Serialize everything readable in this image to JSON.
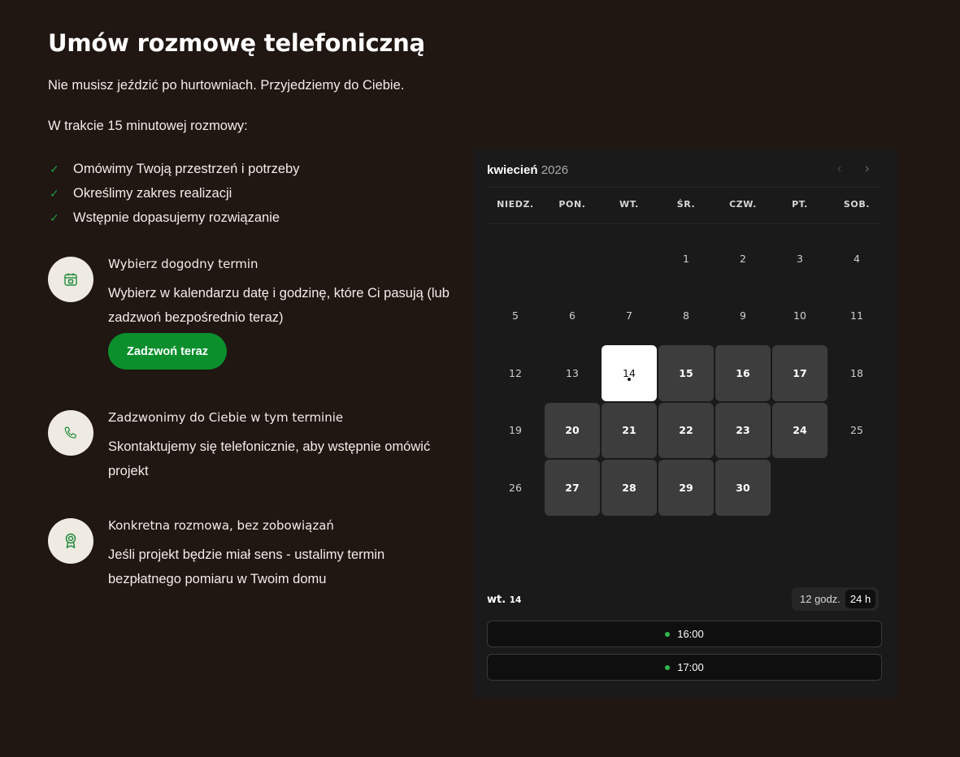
{
  "title": "Umów rozmowę telefoniczną",
  "intro": "Nie musisz jeździć po hurtowniach. Przyjedziemy do Ciebie.",
  "during": "W trakcie 15 minutowej rozmowy:",
  "checklist": [
    "Omówimy Twoją przestrzeń i potrzeby",
    "Określimy zakres realizacji",
    "Wstępnie dopasujemy rozwiązanie"
  ],
  "steps": [
    {
      "title": "Wybierz dogodny termin",
      "desc": "Wybierz w kalendarzu datę i godzinę, które Ci pasują (lub zadzwoń bezpośrednio teraz)",
      "icon": "calendar-icon"
    },
    {
      "title": "Zadzwonimy do Ciebie w tym terminie",
      "desc": "Skontaktujemy się telefonicznie, aby wstępnie omówić projekt",
      "icon": "phone-icon"
    },
    {
      "title": "Konkretna rozmowa, bez zobowiązań",
      "desc": "Jeśli projekt będzie miał sens - ustalimy termin bezpłatnego pomiaru w Twoim domu",
      "icon": "award-icon"
    }
  ],
  "call_button": "Zadzwoń teraz",
  "calendar": {
    "month": "kwiecień",
    "year": "2026",
    "prev": "‹",
    "next": "›",
    "weekdays": [
      "NIEDZ.",
      "PON.",
      "WT.",
      "ŚR.",
      "CZW.",
      "PT.",
      "SOB."
    ],
    "selected_weekday": "wt.",
    "selected_day": "14",
    "format_12": "12 godz.",
    "format_24": "24 h",
    "slots": [
      "16:00",
      "17:00"
    ]
  },
  "colors": {
    "background": "#201612",
    "accent_green": "#0a8f2c",
    "calendar_bg": "#1a1a1a"
  }
}
